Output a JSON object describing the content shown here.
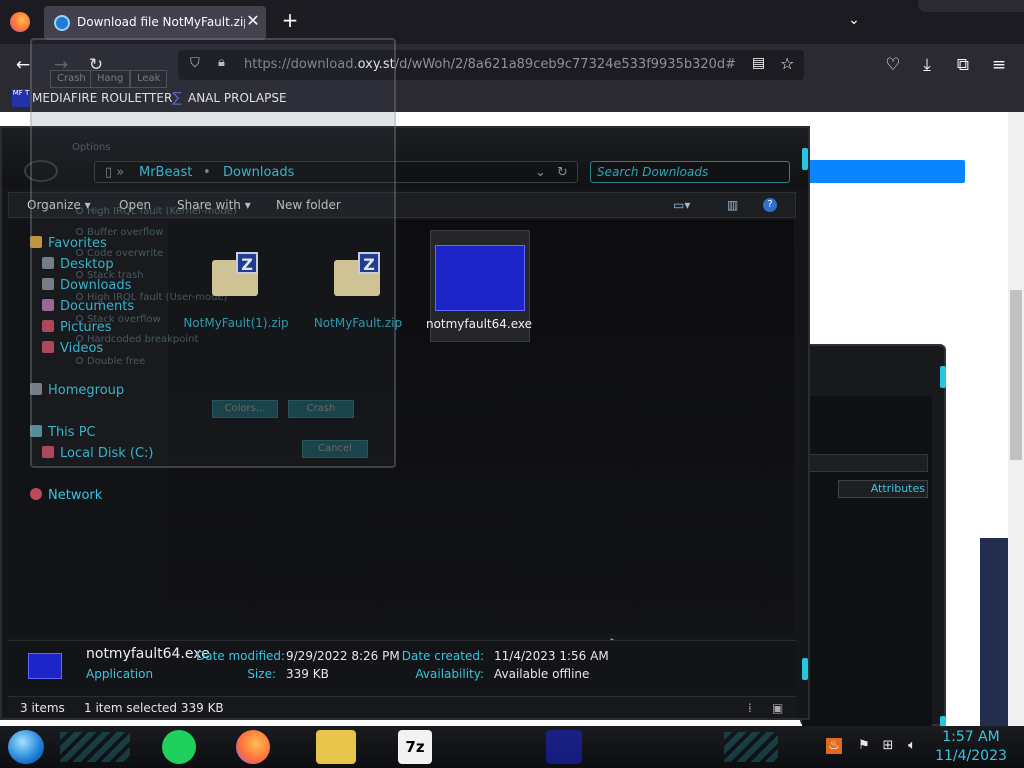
{
  "browser": {
    "tab_title": "Download file NotMyFault.zip o",
    "url_prefix": "https://download.",
    "url_domain": "oxy.st",
    "url_suffix": "/d/wWoh/2/8a621a89ceb9c77324e533f9935b320d#",
    "bookmarks": [
      {
        "label": "MEDIAFIRE ROULETTER",
        "icon_text": "MF T"
      },
      {
        "label": "ANAL PROLAPSE",
        "icon_text": "∑"
      }
    ]
  },
  "explorer": {
    "breadcrumb": [
      "MrBeast",
      "Downloads"
    ],
    "search_placeholder": "Search Downloads",
    "toolbar": {
      "organize": "Organize ▾",
      "open": "Open",
      "share": "Share with ▾",
      "new_folder": "New folder"
    },
    "nav": {
      "favorites": "Favorites",
      "desktop": "Desktop",
      "downloads": "Downloads",
      "documents": "Documents",
      "pictures": "Pictures",
      "videos": "Videos",
      "homegroup": "Homegroup",
      "this_pc": "This PC",
      "local_disk": "Local Disk (C:)",
      "network": "Network"
    },
    "files": [
      {
        "name": "NotMyFault(1).zip",
        "type": "zip"
      },
      {
        "name": "NotMyFault.zip",
        "type": "zip"
      },
      {
        "name": "notmyfault64.exe",
        "type": "exe",
        "selected": true
      }
    ],
    "details": {
      "name": "notmyfault64.exe",
      "type": "Application",
      "date_modified_label": "Date modified:",
      "date_modified": "9/29/2022 8:26 PM",
      "size_label": "Size:",
      "size": "339 KB",
      "date_created_label": "Date created:",
      "date_created": "11/4/2023 1:56 AM",
      "availability_label": "Availability:",
      "availability": "Available offline"
    },
    "status": {
      "items": "3 items",
      "selected": "1 item selected  339 KB"
    }
  },
  "background_window": {
    "column_header": "Attributes"
  },
  "ghost_dialog": {
    "tabs": [
      "Crash",
      "Hang",
      "Leak"
    ],
    "group": "Options",
    "options": [
      "High IRQL fault (Kernel-mode)",
      "Buffer overflow",
      "Code overwrite",
      "Stack trash",
      "High IRQL fault (User-mode)",
      "Stack overflow",
      "Hardcoded breakpoint",
      "Double free"
    ],
    "buttons": {
      "colors": "Colors...",
      "crash": "Crash",
      "cancel": "Cancel"
    }
  },
  "taskbar": {
    "time": "1:57 AM",
    "date": "11/4/2023"
  },
  "colors": {
    "accent": "#37c6e1",
    "bsod_blue": "#1d24c8",
    "firefox_bg": "#2b2a33"
  }
}
